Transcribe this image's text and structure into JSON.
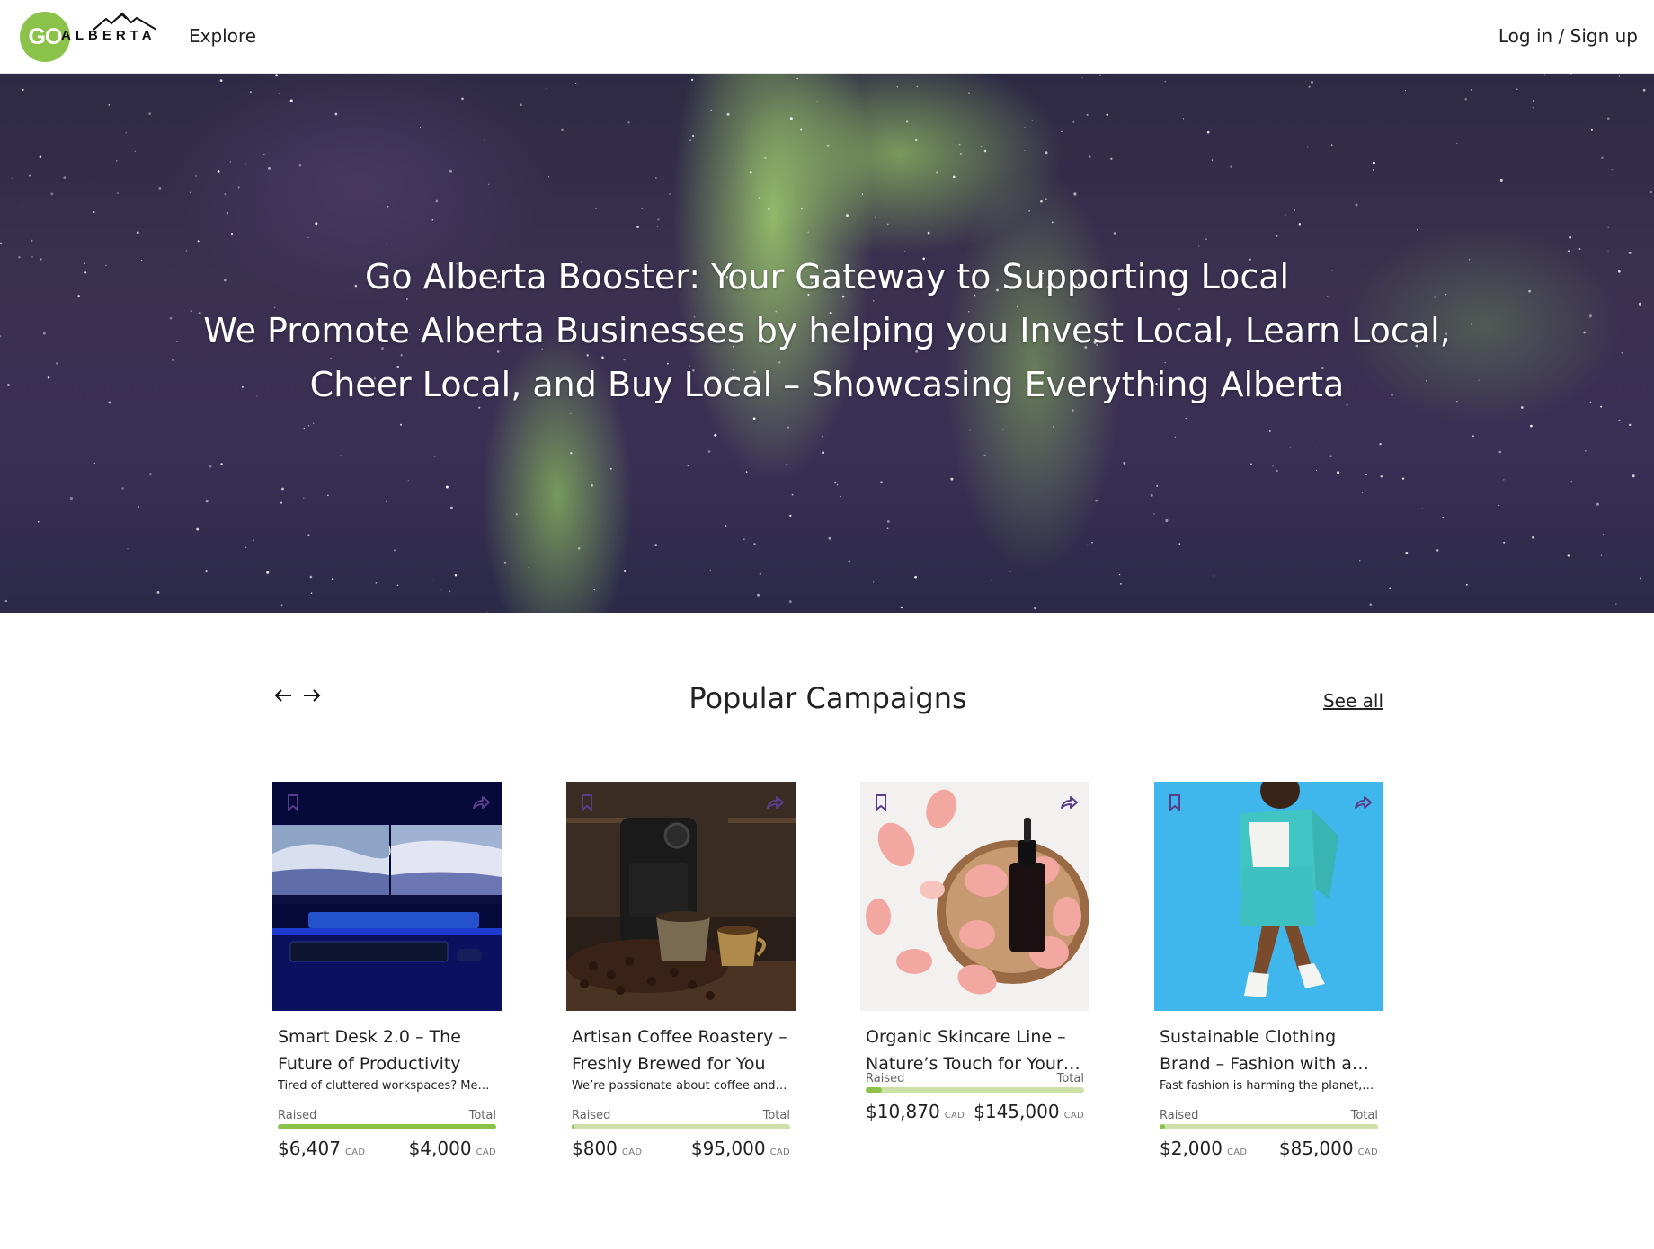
{
  "header": {
    "logo_circle_text": "GO",
    "logo_word": "ALBERTA",
    "explore_label": "Explore",
    "login_label": "Log in / Sign up"
  },
  "hero": {
    "title": "Go Alberta Booster: Your Gateway to Supporting Local",
    "subtitle": "We Promote Alberta Businesses by helping you Invest Local, Learn Local, Cheer Local, and Buy Local – Showcasing Everything Alberta"
  },
  "campaigns": {
    "section_title": "Popular Campaigns",
    "see_all_label": "See all",
    "raised_label": "Raised",
    "total_label": "Total",
    "currency": "CAD",
    "items": [
      {
        "title": "Smart Desk 2.0 – The Future of Productivity",
        "description": "Tired of cluttered workspaces? Mee…",
        "raised": "$6,407",
        "total": "$4,000",
        "progress": 1.0,
        "image": "monitor-desk-setup"
      },
      {
        "title": "Artisan Coffee Roastery – Freshly Brewed for You",
        "description": "We’re passionate about coffee and…",
        "raised": "$800",
        "total": "$95,000",
        "progress": 0.0084,
        "image": "coffee-cups-beans"
      },
      {
        "title": "Organic Skincare Line – Nature’s Touch for Your…",
        "description": "",
        "raised": "$10,870",
        "total": "$145,000",
        "progress": 0.075,
        "image": "serum-bottle-rose-petals"
      },
      {
        "title": "Sustainable Clothing Brand – Fashion with a…",
        "description": "Fast fashion is harming the planet,…",
        "raised": "$2,000",
        "total": "$85,000",
        "progress": 0.0235,
        "image": "model-teal-outfit"
      }
    ]
  },
  "colors": {
    "brand_green": "#8bc34a",
    "progress_track": "#cde0a8",
    "icon_purple": "#5a3d8a"
  }
}
